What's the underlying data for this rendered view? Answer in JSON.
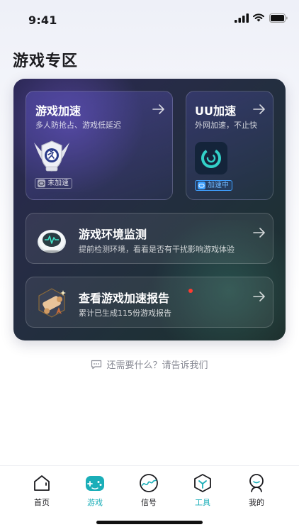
{
  "status_bar": {
    "time": "9:41"
  },
  "page_title": "游戏专区",
  "cards": {
    "game_boost": {
      "title": "游戏加速",
      "subtitle": "多人防抢占、游戏低延迟",
      "badge": "未加速"
    },
    "uu_boost": {
      "title": "UU加速",
      "subtitle": "外网加速，不止快",
      "badge": "加速中"
    },
    "env_monitor": {
      "title": "游戏环境监测",
      "subtitle": "提前检测环境，看看是否有干扰影响游戏体验"
    },
    "report": {
      "title": "查看游戏加速报告",
      "subtitle": "累计已生成115份游戏报告"
    }
  },
  "help_text": "还需要什么？请告诉我们",
  "tabs": [
    {
      "label": "首页",
      "icon": "home-icon"
    },
    {
      "label": "游戏",
      "icon": "gamepad-icon"
    },
    {
      "label": "信号",
      "icon": "signal-globe-icon"
    },
    {
      "label": "工具",
      "icon": "tools-hexagon-icon"
    },
    {
      "label": "我的",
      "icon": "profile-icon"
    }
  ],
  "colors": {
    "accent": "#1aaeb8",
    "badge_active": "#3ea0ff",
    "notification_dot": "#ff3b30"
  }
}
